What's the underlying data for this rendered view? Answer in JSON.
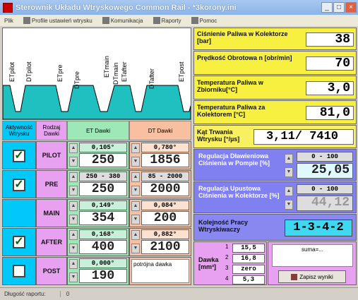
{
  "window": {
    "title": "Sterownik Układu Wtryskowego Common Rail - *3korony.ini"
  },
  "menu": [
    {
      "label": "Plik",
      "icon": "none"
    },
    {
      "label": "Profile ustawień wtrysku",
      "icon": "profile-icon"
    },
    {
      "label": "Komunikacja",
      "icon": "communication-icon"
    },
    {
      "label": "Raporty",
      "icon": "report-icon"
    },
    {
      "label": "Pomoc",
      "icon": "help-icon"
    }
  ],
  "waveform": {
    "labels": [
      "ETpilot",
      "DTpilot",
      "ETpre",
      "DTpre",
      "ETmain",
      "DTmain",
      "ETafter",
      "DTafter",
      "ETpost"
    ]
  },
  "table": {
    "headers": {
      "active": "Aktywność Wtrysku",
      "kind": "Rodzaj Dawki",
      "et": "ET Dawki",
      "dt": "DT Dawki"
    },
    "rows": [
      {
        "active": true,
        "kind": "PILOT",
        "et_small": "0,105°",
        "et_big": "250",
        "dt_small": "0,780°",
        "dt_big": "1856"
      },
      {
        "active": true,
        "kind": "PRE",
        "et_small": "250 - 380",
        "et_big": "250",
        "dt_small": "85 - 2000",
        "dt_big": "2000"
      },
      {
        "active": false,
        "kind": "MAIN",
        "et_small": "0,149°",
        "et_big": "354",
        "dt_small": "0,084°",
        "dt_big": "200"
      },
      {
        "active": true,
        "kind": "AFTER",
        "et_small": "0,168°",
        "et_big": "400",
        "dt_small": "0,882°",
        "dt_big": "2100"
      },
      {
        "active": false,
        "kind": "POST",
        "et_small": "0,000°",
        "et_big": "190",
        "dt_note": "potrójna dawka"
      }
    ]
  },
  "sensors": [
    {
      "label": "Ciśnienie Paliwa w Kolektorze [bar]",
      "value": "38"
    },
    {
      "label": "Prędkość Obrotowa n [obr/min]",
      "value": "70"
    },
    {
      "label": "Temperatura Paliwa w Zbiorniku[°C]",
      "value": "3,0"
    },
    {
      "label": "Temperatura Paliwa za Kolektorem [°C]",
      "value": "81,0"
    }
  ],
  "angle": {
    "label": "Kąt Trwania Wtrysku [°/µs]",
    "value": "3,11/ 7410"
  },
  "reg1": {
    "label": "Regulacja Dławieniowa Ciśnienia w Pompie [%]",
    "range": "0 - 100",
    "value": "25,05"
  },
  "reg2": {
    "label": "Regulacja Upustowa Ciśnienia w Kolektorze [%]",
    "range": "0 - 100",
    "value": "44,12"
  },
  "order": {
    "label": "Kolejność Pracy Wtryskiwaczy",
    "value": "1-3-4-2"
  },
  "dose": {
    "label": "Dawka [mm³]",
    "items": [
      {
        "n": "1",
        "v": "15,5"
      },
      {
        "n": "2",
        "v": "16,8"
      },
      {
        "n": "3",
        "v": "zero"
      },
      {
        "n": "4",
        "v": "5,3"
      }
    ],
    "sum": "suma=...",
    "save": "Zapisz wyniki"
  },
  "status": {
    "label": "Długość raportu:",
    "value": "0"
  }
}
